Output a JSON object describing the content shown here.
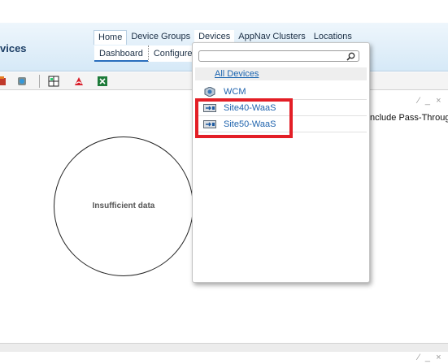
{
  "header": {
    "app_title": "vices"
  },
  "main_tabs": [
    {
      "label": "Home"
    },
    {
      "label": "Device Groups"
    },
    {
      "label": "Devices"
    },
    {
      "label": "AppNav Clusters"
    },
    {
      "label": "Locations"
    }
  ],
  "sub_tabs": [
    {
      "label": "Dashboard"
    },
    {
      "label": "Configure"
    }
  ],
  "toolbar": {
    "icons": [
      "report-icon",
      "refresh-icon",
      "grid-view-icon",
      "pdf-icon",
      "excel-icon"
    ]
  },
  "panel": {
    "controls": "⁄ _ ×",
    "pass_through_label": "nclude Pass-Through",
    "chart_message": "Insufficient data"
  },
  "devices_dropdown": {
    "search_placeholder": "",
    "all_devices_label": "All Devices",
    "items": [
      {
        "label": "WCM",
        "icon": "wcm-device-icon"
      },
      {
        "label": "Site40-WaaS",
        "icon": "waas-device-icon"
      },
      {
        "label": "Site50-WaaS",
        "icon": "waas-device-icon"
      }
    ]
  },
  "bottom_panel": {
    "controls": "⁄ _ ×"
  },
  "colors": {
    "highlight": "#e31e26",
    "link": "#1f63ad",
    "header_bg": "#d6e9f7"
  }
}
